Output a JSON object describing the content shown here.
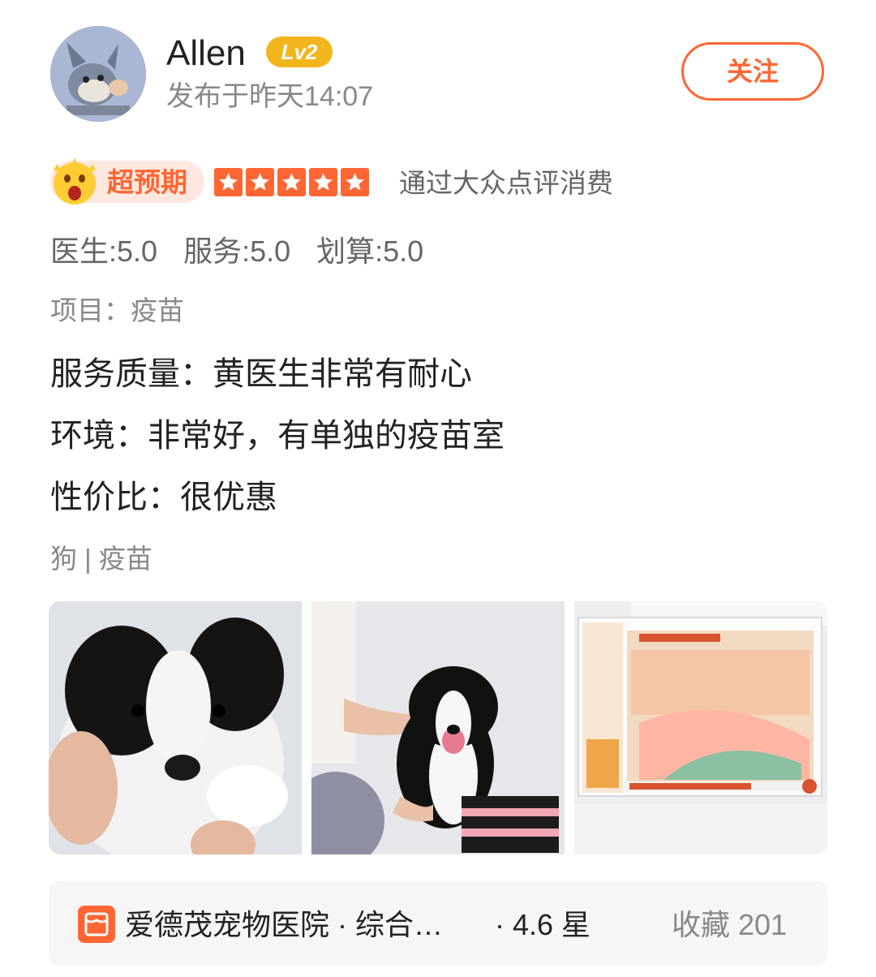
{
  "user": {
    "name": "Allen",
    "level": "Lv2",
    "post_time": "发布于昨天14:07",
    "follow_label": "关注"
  },
  "rating": {
    "tag": "超预期",
    "stars": 5,
    "source": "通过大众点评消费",
    "scores": [
      "医生:5.0",
      "服务:5.0",
      "划算:5.0"
    ]
  },
  "review": {
    "project": "项目：疫苗",
    "lines": [
      "服务质量：黄医生非常有耐心",
      "环境：非常好，有单独的疫苗室",
      "性价比：很优惠"
    ],
    "tags": "狗 | 疫苗"
  },
  "shop": {
    "name": "爱德茂宠物医院 · 综合…",
    "rating": "· 4.6 星",
    "favorites": "收藏 201"
  },
  "colors": {
    "accent": "#ff6633",
    "level_badge": "#f3b51d",
    "muted": "#888888"
  }
}
